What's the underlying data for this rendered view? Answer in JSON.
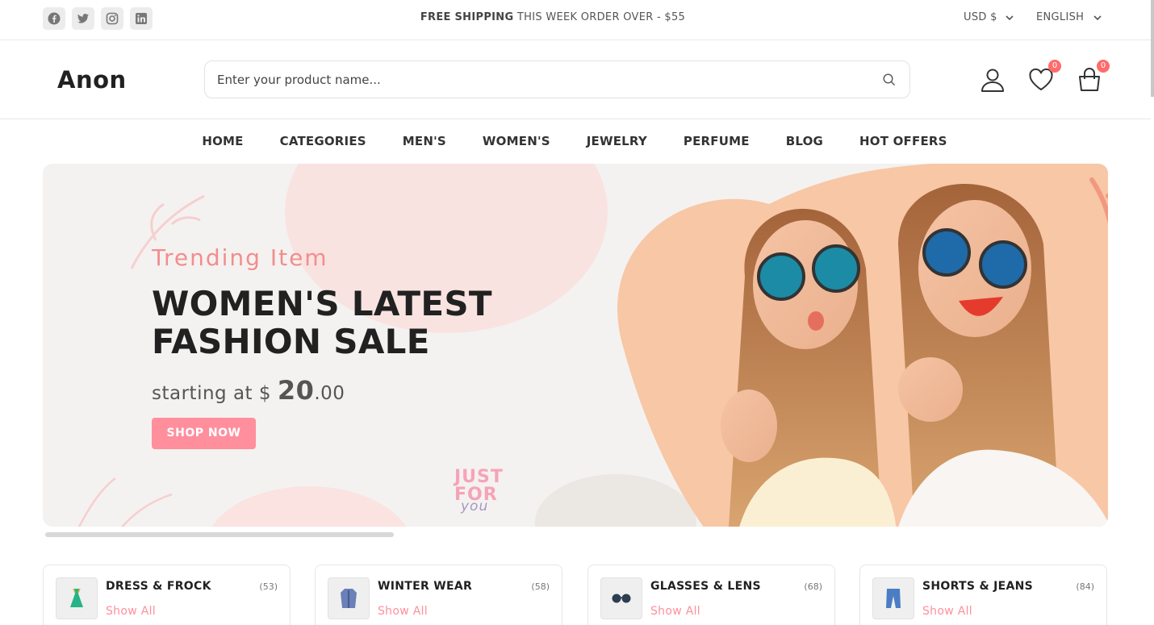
{
  "topbar": {
    "social": [
      "facebook-icon",
      "twitter-icon",
      "instagram-icon",
      "linkedin-icon"
    ],
    "promo_bold": "FREE SHIPPING",
    "promo_rest": " THIS WEEK ORDER OVER - $55",
    "currency": "USD $",
    "language": "ENGLISH"
  },
  "header": {
    "logo": "Anon",
    "search_placeholder": "Enter your product name...",
    "wishlist_count": "0",
    "cart_count": "0"
  },
  "nav": [
    "HOME",
    "CATEGORIES",
    "MEN'S",
    "WOMEN'S",
    "JEWELRY",
    "PERFUME",
    "BLOG",
    "HOT OFFERS"
  ],
  "banner": {
    "subtitle": "Trending Item",
    "title": "WOMEN'S LATEST FASHION SALE",
    "price_prefix": "starting at $ ",
    "price_whole": "20",
    "price_cents": ".00",
    "button": "SHOP NOW",
    "badge_line1": "JUST",
    "badge_line2": "FOR",
    "badge_line3": "you"
  },
  "categories": [
    {
      "name": "DRESS & FROCK",
      "count": "(53)",
      "link": "Show All",
      "icon": "dress-icon"
    },
    {
      "name": "WINTER WEAR",
      "count": "(58)",
      "link": "Show All",
      "icon": "coat-icon"
    },
    {
      "name": "GLASSES & LENS",
      "count": "(68)",
      "link": "Show All",
      "icon": "glasses-icon"
    },
    {
      "name": "SHORTS & JEANS",
      "count": "(84)",
      "link": "Show All",
      "icon": "jeans-icon"
    }
  ],
  "colors": {
    "accent": "#ff8f9c",
    "badge": "#ff6b6b",
    "banner_bg": "#f4f2f0"
  }
}
